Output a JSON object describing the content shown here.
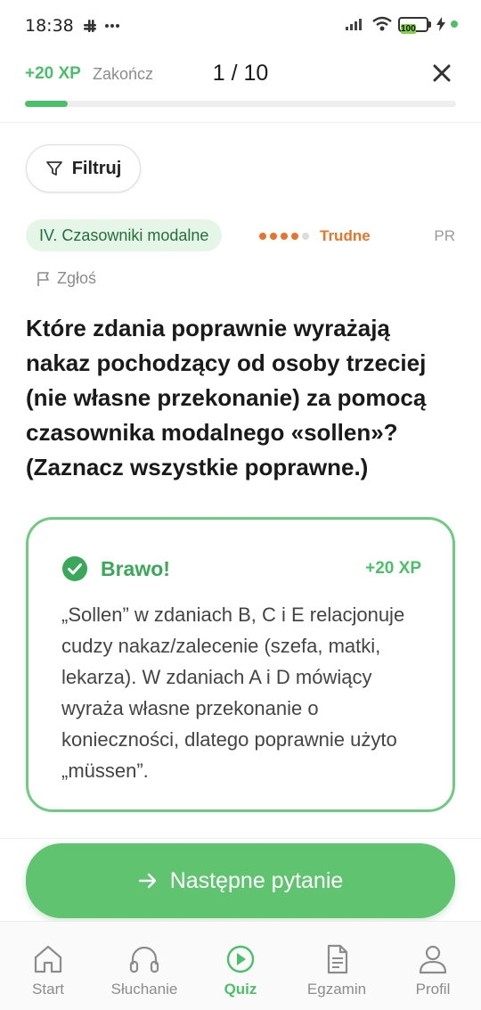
{
  "status_bar": {
    "time": "18:38",
    "battery": "100"
  },
  "header": {
    "xp": "+20 XP",
    "finish_label": "Zakończ",
    "progress_text": "1 / 10",
    "progress_fraction": 0.1
  },
  "filter": {
    "label": "Filtruj"
  },
  "meta": {
    "category": "IV. Czasowniki modalne",
    "difficulty_label": "Trudne",
    "difficulty_level": 4,
    "difficulty_max": 5,
    "language": "PR",
    "report_label": "Zgłoś"
  },
  "question": {
    "text": "Które zdania poprawnie wyrażają nakaz pochodzący od osoby trzeciej (nie własne przekonanie) za pomocą czasownika modalnego «sollen»? (Zaznacz wszystkie poprawne.)"
  },
  "feedback": {
    "title": "Brawo!",
    "xp": "+20 XP",
    "text": "„Sollen” w zdaniach B, C i E relacjonuje cudzy nakaz/zalecenie (szefa, matki, lekarza). W zdaniach A i D mówiący wyraża własne przekonanie o konieczności, dlatego poprawnie użyto „müssen”."
  },
  "next_button": {
    "label": "Następne pytanie"
  },
  "nav": [
    {
      "label": "Start",
      "icon": "home-icon",
      "active": false
    },
    {
      "label": "Słuchanie",
      "icon": "headphones-icon",
      "active": false
    },
    {
      "label": "Quiz",
      "icon": "play-circle-icon",
      "active": true
    },
    {
      "label": "Egzamin",
      "icon": "document-icon",
      "active": false
    },
    {
      "label": "Profil",
      "icon": "user-icon",
      "active": false
    }
  ],
  "colors": {
    "accent": "#4cbf6a",
    "difficulty": "#e8742b",
    "chip_bg": "#e5f6e8",
    "button": "#5fc36f"
  }
}
